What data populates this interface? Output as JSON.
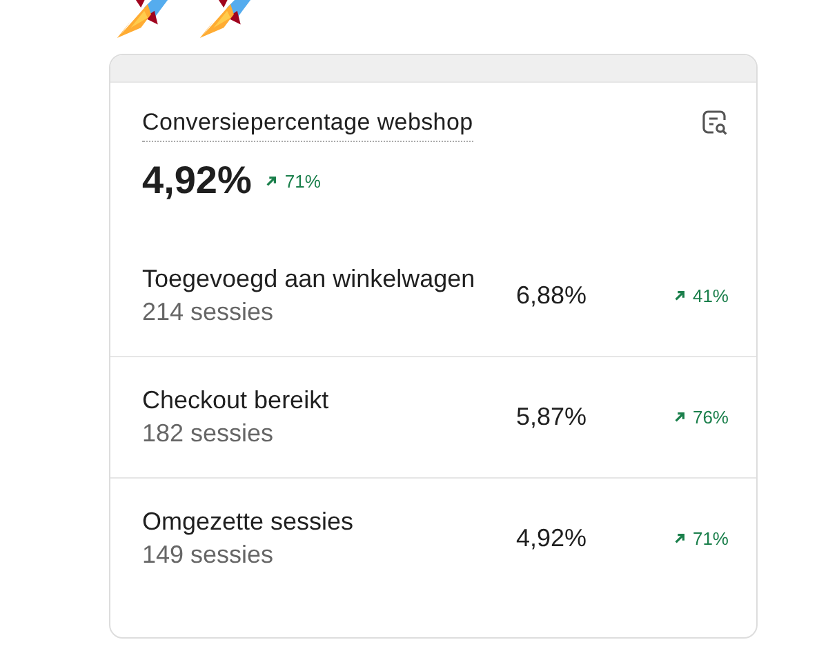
{
  "decorations": [
    {
      "kind": "rocket"
    },
    {
      "kind": "rocket"
    }
  ],
  "card": {
    "title": "Conversiepercentage webshop",
    "value": "4,92%",
    "change": {
      "trend_up": true,
      "text": "71%"
    },
    "rows": [
      {
        "label": "Toegevoegd aan winkelwagen",
        "sessions": "214 sessies",
        "rate": "6,88%",
        "change": {
          "trend_up": true,
          "text": "41%"
        }
      },
      {
        "label": "Checkout bereikt",
        "sessions": "182 sessies",
        "rate": "5,87%",
        "change": {
          "trend_up": true,
          "text": "76%"
        }
      },
      {
        "label": "Omgezette sessies",
        "sessions": "149 sessies",
        "rate": "4,92%",
        "change": {
          "trend_up": true,
          "text": "71%"
        }
      }
    ]
  }
}
